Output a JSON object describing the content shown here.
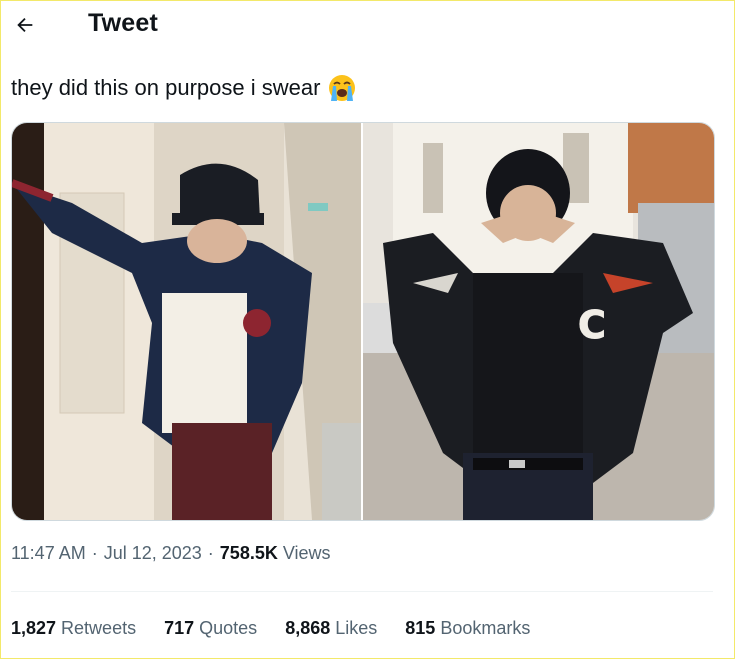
{
  "header": {
    "title": "Tweet",
    "back_icon": "arrow-left-icon"
  },
  "tweet": {
    "text": "they did this on purpose i swear",
    "emoji": "loudly-crying-face-emoji",
    "media": [
      {
        "description": "person in cap and varsity jacket covering face in a hallway"
      },
      {
        "description": "person in black varsity jacket covering eyes on a street"
      }
    ],
    "time": "11:47 AM",
    "date": "Jul 12, 2023",
    "separator": "·",
    "views_count": "758.5K",
    "views_label": "Views"
  },
  "stats": [
    {
      "count": "1,827",
      "label": "Retweets"
    },
    {
      "count": "717",
      "label": "Quotes"
    },
    {
      "count": "8,868",
      "label": "Likes"
    },
    {
      "count": "815",
      "label": "Bookmarks"
    }
  ],
  "colors": {
    "text": "#0f1419",
    "secondary": "#536471",
    "divider": "#eff3f4",
    "border": "#f3e96a"
  }
}
